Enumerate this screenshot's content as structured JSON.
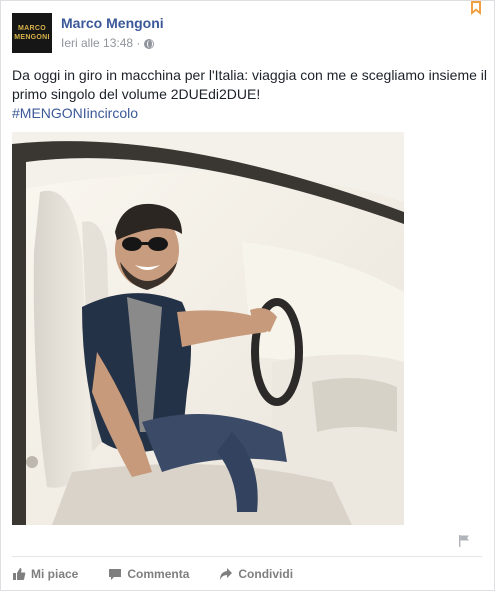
{
  "post": {
    "author": "Marco Mengoni",
    "avatar_text": [
      "MARCO",
      "MENGONI"
    ],
    "timestamp": "Ieri alle 13:48 ·",
    "privacy_icon": "globe-icon",
    "text": "Da oggi in giro in macchina per l'Italia: viaggia con me e scegliamo insieme il primo singolo del volume 2DUEdi2DUE!",
    "hashtag": "#MENGONIincircolo",
    "photo_icon": "photo-of-man-in-car"
  },
  "actions": {
    "like": "Mi piace",
    "comment": "Commenta",
    "share": "Condividi"
  },
  "colors": {
    "link": "#3b5998",
    "meta": "#90949c",
    "action": "#7f7f7f",
    "bookmark": "#f0a040"
  }
}
